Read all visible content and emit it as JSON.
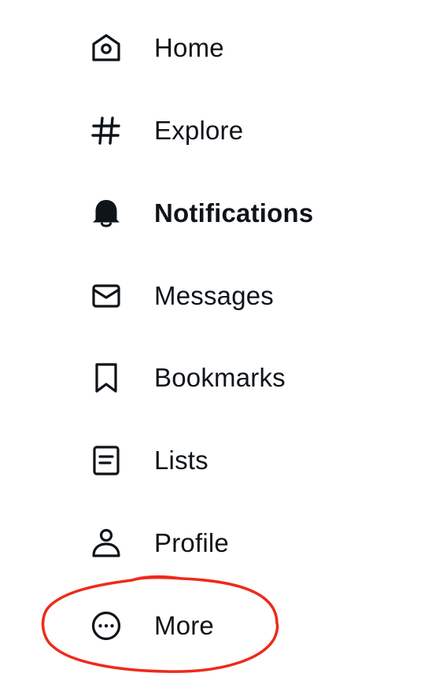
{
  "nav": {
    "items": [
      {
        "key": "home",
        "label": "Home",
        "icon": "home-icon",
        "active": false
      },
      {
        "key": "explore",
        "label": "Explore",
        "icon": "hashtag-icon",
        "active": false
      },
      {
        "key": "notifications",
        "label": "Notifications",
        "icon": "bell-icon",
        "active": true
      },
      {
        "key": "messages",
        "label": "Messages",
        "icon": "envelope-icon",
        "active": false
      },
      {
        "key": "bookmarks",
        "label": "Bookmarks",
        "icon": "bookmark-icon",
        "active": false
      },
      {
        "key": "lists",
        "label": "Lists",
        "icon": "list-document-icon",
        "active": false
      },
      {
        "key": "profile",
        "label": "Profile",
        "icon": "person-icon",
        "active": false
      },
      {
        "key": "more",
        "label": "More",
        "icon": "more-circle-icon",
        "active": false
      }
    ]
  },
  "colors": {
    "text": "#0f1419",
    "background": "#ffffff",
    "annotation_circle": "#ee2a1a"
  }
}
